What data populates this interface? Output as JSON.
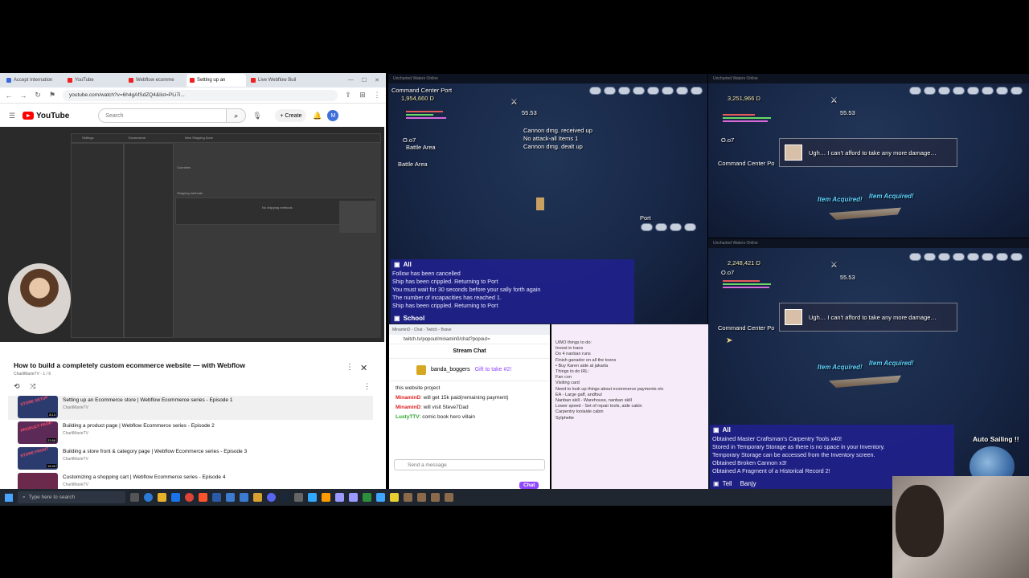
{
  "browser": {
    "tabs": [
      "Accept Internation",
      "YouTube",
      "Webflow ecomme",
      "Setting up an",
      "Live Webflow Buil"
    ],
    "active_tab": 3,
    "url": "youtube.com/watch?v=6h4gAfSdZQ4&list=PLi7i...",
    "search_placeholder": "Search",
    "create_label": "Create",
    "avatar_letter": "M",
    "logo": "YouTube"
  },
  "video_ui": {
    "settings": "Settings",
    "ecommerce": "Ecommerce",
    "zone": "New Shipping Zone",
    "no_methods": "No shipping methods",
    "shipping_methods": "Shipping methods",
    "countries": "Countries"
  },
  "playlist": {
    "title": "How to build a completely custom ecommerce website — with Webflow",
    "sub": "CharliMarieTV - 1 / 6",
    "items": [
      {
        "name": "Setting up an Ecommerce store | Webflow Ecommerce series - Episode 1",
        "channel": "CharliMarieTV",
        "duration": "8:13",
        "thumb": "STORE SETUP"
      },
      {
        "name": "Building a product page | Webflow Ecommerce series - Episode 2",
        "channel": "CharliMarieTV",
        "duration": "22:55",
        "thumb": "PRODUCT PAGE"
      },
      {
        "name": "Building a store front & category page | Webflow Ecommerce series - Episode 3",
        "channel": "CharliMarieTV",
        "duration": "15:49",
        "thumb": "STORE FRONT"
      },
      {
        "name": "Customizing a shopping cart | Webflow Ecommerce series - Episode 4",
        "channel": "CharliMarieTV",
        "duration": "",
        "thumb": ""
      }
    ]
  },
  "game1": {
    "window_title": "Uncharted Waters Online",
    "location": "Command Center Port",
    "ducats": "1,954,660 D",
    "date": "O.o7",
    "area1": "Battle Area",
    "area2": "Battle Area",
    "count": "55.53",
    "status": [
      "Cannon dmg. received up",
      "No attack-all Items 1",
      "Cannon dmg. dealt up"
    ],
    "port_label": "Port",
    "chat_tab": "All",
    "chat": [
      "Follow has been cancelled",
      "Ship has been crippled. Returning to Port",
      "You must wait for 30 seconds before your sally forth again",
      "The number of incapacities has reached 1.",
      "Ship has been crippled. Returning to Port"
    ],
    "school_tab": "School"
  },
  "game2": {
    "window_title": "Uncharted Waters Online",
    "ducats": "3,251,966 D",
    "count": "55.53",
    "date": "O.o7",
    "location": "Command Center Po",
    "dialog": "Ugh… I can't afford to take any more damage…",
    "item1": "Item Acquired!",
    "item2": "Item Acquired!"
  },
  "game3": {
    "window_title": "Uncharted Waters Online",
    "ducats": "2,248,421 D",
    "count": "55.53",
    "date": "O.o7",
    "location": "Command Center Po",
    "dialog": "Ugh… I can't afford to take any more damage…",
    "item1": "Item Acquired!",
    "item2": "Item Acquired!",
    "chat_tab": "All",
    "chat": [
      "Obtained Master Craftsman's Carpentry Tools x40!",
      "Stored in Temporary Storage as there is no space in your Inventory.",
      "Temporary Storage can be accessed from the Inventory screen.",
      "Obtained Broken Cannon x3!",
      "Obtained A Fragment of a Historical Record 2!"
    ],
    "tell_tab": "Tell",
    "tell_name": "Banjy",
    "auto_sailing": "Auto Sailing !!"
  },
  "twitch": {
    "window_title": "MinaminD - Chat - Twitch - Brave",
    "url": "twitch.tv/popout/minamin0/chat?popout=",
    "header": "Stream Chat",
    "gift_user": "banda_boggers",
    "gift_text": "Gift to take #2!",
    "gift_count": "1",
    "messages": [
      {
        "user": "",
        "text": "this website project"
      },
      {
        "user": "MinaminD",
        "text": ": will get 15k paid(remaining payment)"
      },
      {
        "user": "MinaminD",
        "text": ": will visit Steve7Dad"
      },
      {
        "user": "LustyTTV",
        "text": ": comic book hero villain"
      }
    ],
    "send_placeholder": "Send a message",
    "chat_button": "Chat"
  },
  "notes": {
    "lines": [
      "UWO things to do:",
      "",
      "Invest in trans",
      "Do 4 nanban runs",
      "Finish ganador on all the toons",
      "",
      "• Buy Karen aide at jakarta",
      "",
      "Things to do IRL:",
      "Fan con",
      "Visiting card",
      "Need to look up things about ecommerce payments etc",
      "",
      "EA - Large gaff, andfoul",
      "Nanban skill - Warehouse, nanban skill",
      "Lower speed - Set of repair tools, aide cabin",
      "Carpentry toolaide cabin",
      "",
      "",
      "Sylphette"
    ]
  },
  "taskbar": {
    "search_placeholder": "Type here to search"
  }
}
